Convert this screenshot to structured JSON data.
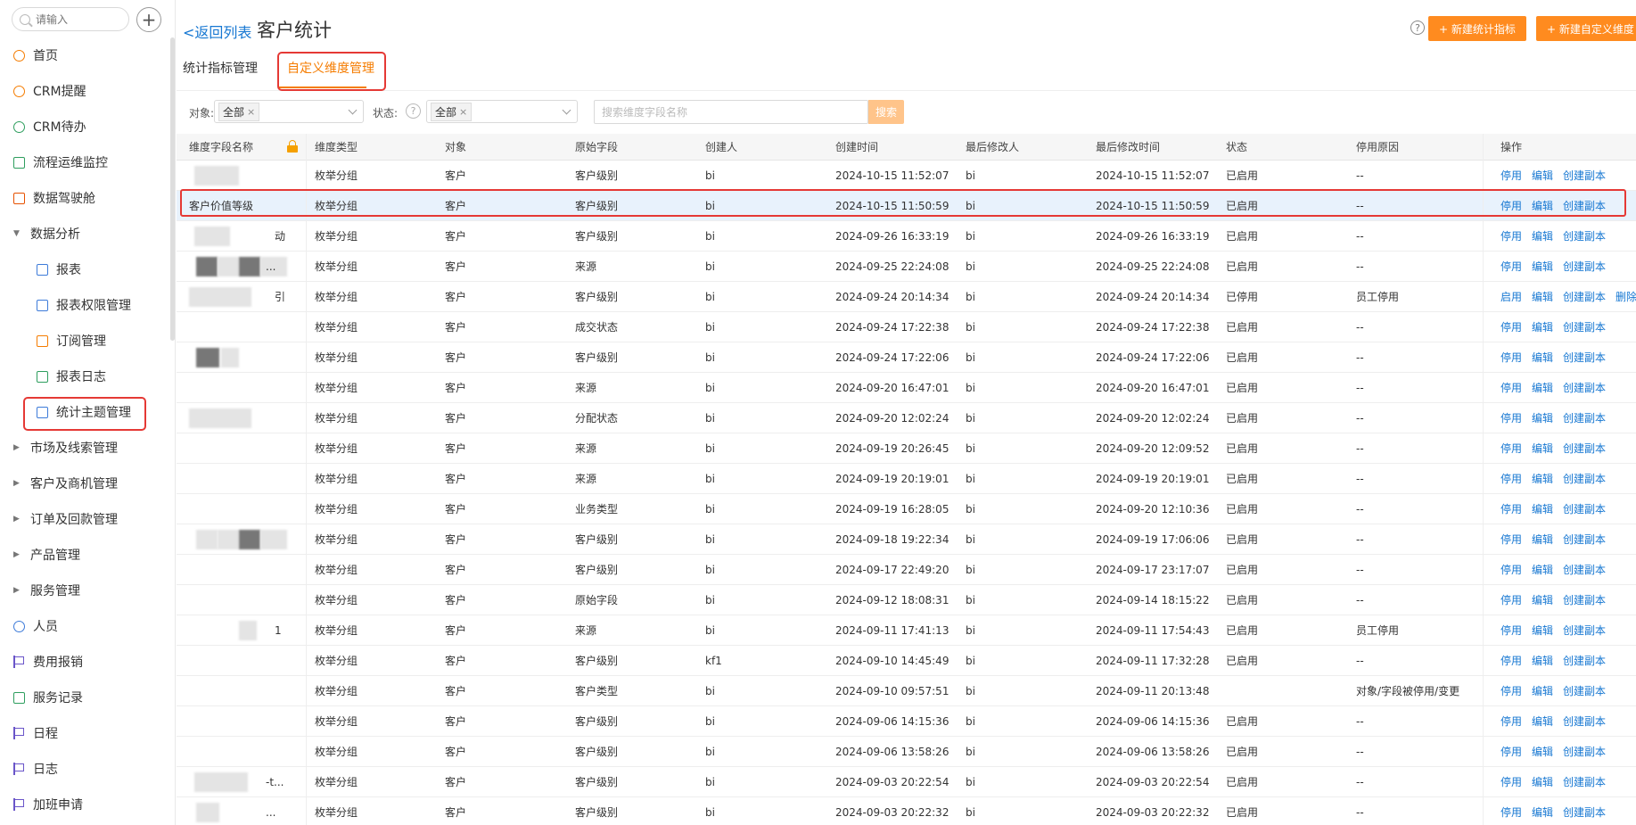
{
  "sidebar": {
    "search_placeholder": "请输入",
    "add_label": "+",
    "items": [
      {
        "label": "首页",
        "icon": "home-icon",
        "color": "#f57c00"
      },
      {
        "label": "CRM提醒",
        "icon": "bell-icon",
        "color": "#f57c00"
      },
      {
        "label": "CRM待办",
        "icon": "check-circle-icon",
        "color": "#2e9e5e"
      },
      {
        "label": "流程运维监控",
        "icon": "flow-icon",
        "color": "#2e9e5e"
      },
      {
        "label": "数据驾驶舱",
        "icon": "dashboard-icon",
        "color": "#e65100"
      },
      {
        "label": "数据分析",
        "icon": "caret-down-icon"
      },
      {
        "label": "报表",
        "icon": "report-icon",
        "color": "#3d7bd9"
      },
      {
        "label": "报表权限管理",
        "icon": "report-permission-icon",
        "color": "#3d7bd9"
      },
      {
        "label": "订阅管理",
        "icon": "subscribe-icon",
        "color": "#f57c00"
      },
      {
        "label": "报表日志",
        "icon": "log-icon",
        "color": "#2e9e5e"
      },
      {
        "label": "统计主题管理",
        "icon": "stats-theme-icon",
        "color": "#3d7bd9"
      },
      {
        "label": "市场及线索管理",
        "icon": "caret-right-icon"
      },
      {
        "label": "客户及商机管理",
        "icon": "caret-right-icon"
      },
      {
        "label": "订单及回款管理",
        "icon": "caret-right-icon"
      },
      {
        "label": "产品管理",
        "icon": "caret-right-icon"
      },
      {
        "label": "服务管理",
        "icon": "caret-right-icon"
      },
      {
        "label": "人员",
        "icon": "people-icon",
        "color": "#3d7bd9"
      },
      {
        "label": "费用报销",
        "icon": "flag-icon",
        "color": "#6a55c9"
      },
      {
        "label": "服务记录",
        "icon": "service-record-icon",
        "color": "#2e9e5e"
      },
      {
        "label": "日程",
        "icon": "flag-icon",
        "color": "#6a55c9"
      },
      {
        "label": "日志",
        "icon": "flag-icon",
        "color": "#6a55c9"
      },
      {
        "label": "加班申请",
        "icon": "flag-icon",
        "color": "#6a55c9"
      }
    ]
  },
  "header": {
    "back_label": "<返回列表",
    "title": "客户统计",
    "help": "?",
    "new_metric_label": "+ 新建统计指标",
    "new_dimension_label": "+ 新建自定义维度"
  },
  "tabs": [
    {
      "label": "统计指标管理"
    },
    {
      "label": "自定义维度管理"
    }
  ],
  "filters": {
    "object_label": "对象:",
    "object_value": "全部",
    "status_label": "状态:",
    "status_value": "全部",
    "search_placeholder": "搜索维度字段名称",
    "search_button": "搜索"
  },
  "table": {
    "columns": [
      "维度字段名称",
      "维度类型",
      "对象",
      "原始字段",
      "创建人",
      "创建时间",
      "最后修改人",
      "最后修改时间",
      "状态",
      "停用原因",
      "操作"
    ],
    "rows": [
      {
        "name": "",
        "type": "枚举分组",
        "object": "客户",
        "field": "客户级别",
        "creator": "bi",
        "created": "2024-10-15 11:52:07",
        "modifier": "bi",
        "modified": "2024-10-15 11:52:07",
        "status": "已启用",
        "reason": "--",
        "actions": [
          "停用",
          "编辑",
          "创建副本"
        ]
      },
      {
        "name": "客户价值等级",
        "type": "枚举分组",
        "object": "客户",
        "field": "客户级别",
        "creator": "bi",
        "created": "2024-10-15 11:50:59",
        "modifier": "bi",
        "modified": "2024-10-15 11:50:59",
        "status": "已启用",
        "reason": "--",
        "actions": [
          "停用",
          "编辑",
          "创建副本"
        ]
      },
      {
        "name": "动",
        "type": "枚举分组",
        "object": "客户",
        "field": "客户级别",
        "creator": "bi",
        "created": "2024-09-26 16:33:19",
        "modifier": "bi",
        "modified": "2024-09-26 16:33:19",
        "status": "已启用",
        "reason": "--",
        "actions": [
          "停用",
          "编辑",
          "创建副本"
        ]
      },
      {
        "name": "...",
        "type": "枚举分组",
        "object": "客户",
        "field": "来源",
        "creator": "bi",
        "created": "2024-09-25 22:24:08",
        "modifier": "bi",
        "modified": "2024-09-25 22:24:08",
        "status": "已启用",
        "reason": "--",
        "actions": [
          "停用",
          "编辑",
          "创建副本"
        ]
      },
      {
        "name": "引",
        "type": "枚举分组",
        "object": "客户",
        "field": "客户级别",
        "creator": "bi",
        "created": "2024-09-24 20:14:34",
        "modifier": "bi",
        "modified": "2024-09-24 20:14:34",
        "status": "已停用",
        "reason": "员工停用",
        "actions": [
          "启用",
          "编辑",
          "创建副本",
          "删除"
        ]
      },
      {
        "name": "",
        "type": "枚举分组",
        "object": "客户",
        "field": "成交状态",
        "creator": "bi",
        "created": "2024-09-24 17:22:38",
        "modifier": "bi",
        "modified": "2024-09-24 17:22:38",
        "status": "已启用",
        "reason": "--",
        "actions": [
          "停用",
          "编辑",
          "创建副本"
        ]
      },
      {
        "name": "",
        "type": "枚举分组",
        "object": "客户",
        "field": "客户级别",
        "creator": "bi",
        "created": "2024-09-24 17:22:06",
        "modifier": "bi",
        "modified": "2024-09-24 17:22:06",
        "status": "已启用",
        "reason": "--",
        "actions": [
          "停用",
          "编辑",
          "创建副本"
        ]
      },
      {
        "name": "",
        "type": "枚举分组",
        "object": "客户",
        "field": "来源",
        "creator": "bi",
        "created": "2024-09-20 16:47:01",
        "modifier": "bi",
        "modified": "2024-09-20 16:47:01",
        "status": "已启用",
        "reason": "--",
        "actions": [
          "停用",
          "编辑",
          "创建副本"
        ]
      },
      {
        "name": "",
        "type": "枚举分组",
        "object": "客户",
        "field": "分配状态",
        "creator": "bi",
        "created": "2024-09-20 12:02:24",
        "modifier": "bi",
        "modified": "2024-09-20 12:02:24",
        "status": "已启用",
        "reason": "--",
        "actions": [
          "停用",
          "编辑",
          "创建副本"
        ]
      },
      {
        "name": "",
        "type": "枚举分组",
        "object": "客户",
        "field": "来源",
        "creator": "bi",
        "created": "2024-09-19 20:26:45",
        "modifier": "bi",
        "modified": "2024-09-20 12:09:52",
        "status": "已启用",
        "reason": "--",
        "actions": [
          "停用",
          "编辑",
          "创建副本"
        ]
      },
      {
        "name": "",
        "type": "枚举分组",
        "object": "客户",
        "field": "来源",
        "creator": "bi",
        "created": "2024-09-19 20:19:01",
        "modifier": "bi",
        "modified": "2024-09-19 20:19:01",
        "status": "已启用",
        "reason": "--",
        "actions": [
          "停用",
          "编辑",
          "创建副本"
        ]
      },
      {
        "name": "",
        "type": "枚举分组",
        "object": "客户",
        "field": "业务类型",
        "creator": "bi",
        "created": "2024-09-19 16:28:05",
        "modifier": "bi",
        "modified": "2024-09-20 12:10:36",
        "status": "已启用",
        "reason": "--",
        "actions": [
          "停用",
          "编辑",
          "创建副本"
        ]
      },
      {
        "name": "",
        "type": "枚举分组",
        "object": "客户",
        "field": "客户级别",
        "creator": "bi",
        "created": "2024-09-18 19:22:34",
        "modifier": "bi",
        "modified": "2024-09-19 17:06:06",
        "status": "已启用",
        "reason": "--",
        "actions": [
          "停用",
          "编辑",
          "创建副本"
        ]
      },
      {
        "name": "",
        "type": "枚举分组",
        "object": "客户",
        "field": "客户级别",
        "creator": "bi",
        "created": "2024-09-17 22:49:20",
        "modifier": "bi",
        "modified": "2024-09-17 23:17:07",
        "status": "已启用",
        "reason": "--",
        "actions": [
          "停用",
          "编辑",
          "创建副本"
        ]
      },
      {
        "name": "",
        "type": "枚举分组",
        "object": "客户",
        "field": "原始字段",
        "creator": "bi",
        "created": "2024-09-12 18:08:31",
        "modifier": "bi",
        "modified": "2024-09-14 18:15:22",
        "status": "已启用",
        "reason": "--",
        "actions": [
          "停用",
          "编辑",
          "创建副本"
        ]
      },
      {
        "name": "1",
        "type": "枚举分组",
        "object": "客户",
        "field": "来源",
        "creator": "bi",
        "created": "2024-09-11 17:41:13",
        "modifier": "bi",
        "modified": "2024-09-11 17:54:43",
        "status": "已启用",
        "reason": "员工停用",
        "actions": [
          "停用",
          "编辑",
          "创建副本"
        ]
      },
      {
        "name": "",
        "type": "枚举分组",
        "object": "客户",
        "field": "客户级别",
        "creator": "kf1",
        "created": "2024-09-10 14:45:49",
        "modifier": "bi",
        "modified": "2024-09-11 17:32:28",
        "status": "已启用",
        "reason": "--",
        "actions": [
          "停用",
          "编辑",
          "创建副本"
        ]
      },
      {
        "name": "",
        "type": "枚举分组",
        "object": "客户",
        "field": "客户类型",
        "creator": "bi",
        "created": "2024-09-10 09:57:51",
        "modifier": "bi",
        "modified": "2024-09-11 20:13:48",
        "status": "",
        "reason": "对象/字段被停用/变更",
        "actions": [
          "停用",
          "编辑",
          "创建副本"
        ]
      },
      {
        "name": "",
        "type": "枚举分组",
        "object": "客户",
        "field": "客户级别",
        "creator": "bi",
        "created": "2024-09-06 14:15:36",
        "modifier": "bi",
        "modified": "2024-09-06 14:15:36",
        "status": "已启用",
        "reason": "--",
        "actions": [
          "停用",
          "编辑",
          "创建副本"
        ]
      },
      {
        "name": "",
        "type": "枚举分组",
        "object": "客户",
        "field": "客户级别",
        "creator": "bi",
        "created": "2024-09-06 13:58:26",
        "modifier": "bi",
        "modified": "2024-09-06 13:58:26",
        "status": "已启用",
        "reason": "--",
        "actions": [
          "停用",
          "编辑",
          "创建副本"
        ]
      },
      {
        "name": "-t...",
        "type": "枚举分组",
        "object": "客户",
        "field": "客户级别",
        "creator": "bi",
        "created": "2024-09-03 20:22:54",
        "modifier": "bi",
        "modified": "2024-09-03 20:22:54",
        "status": "已启用",
        "reason": "--",
        "actions": [
          "停用",
          "编辑",
          "创建副本"
        ]
      },
      {
        "name": "...",
        "type": "枚举分组",
        "object": "客户",
        "field": "客户级别",
        "creator": "bi",
        "created": "2024-09-03 20:22:32",
        "modifier": "bi",
        "modified": "2024-09-03 20:22:32",
        "status": "已启用",
        "reason": "--",
        "actions": [
          "停用",
          "编辑",
          "创建副本"
        ]
      }
    ]
  }
}
